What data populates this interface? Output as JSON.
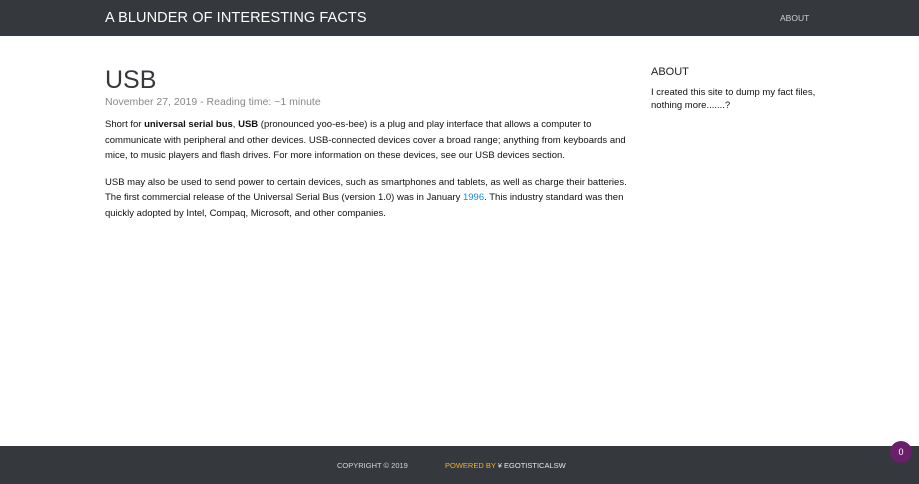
{
  "header": {
    "site_title": "A BLUNDER OF INTERESTING FACTS",
    "nav_about": "ABOUT"
  },
  "post": {
    "title": "USB",
    "meta": "November 27, 2019 - Reading time: ~1 minute",
    "p1": {
      "t1": "Short for ",
      "b1": "universal serial bus",
      "t2": ", ",
      "b2": "USB",
      "t3": " (pronounced yoo-es-bee) is a plug and play interface that allows a computer to communicate with peripheral and other devices. USB-connected devices cover a broad range; anything from keyboards and mice, to music players and flash drives. For more information on these devices, see our USB devices section."
    },
    "p2": {
      "t1": "USB may also be used to send power to certain devices, such as smartphones and tablets, as well as charge their batteries. The first commercial release of the Universal Serial Bus (version 1.0) was in January ",
      "link": "1996",
      "t2": ". This industry standard was then quickly adopted by Intel, Compaq, Microsoft, and other companies."
    }
  },
  "sidebar": {
    "heading": "ABOUT",
    "text": "I created this site to dump my fact files, nothing more.......?"
  },
  "footer": {
    "copyright": "COPYRIGHT © 2019",
    "powered_label": "POWERED BY ",
    "powered_icon": "¥",
    "powered_name": " EGOTISTICALSW"
  },
  "badge": {
    "count": "0"
  },
  "colors": {
    "bar_background": "#35383d",
    "link": "#1e88e5",
    "powered_accent": "#f0b429",
    "badge": "#6a1f6b"
  }
}
